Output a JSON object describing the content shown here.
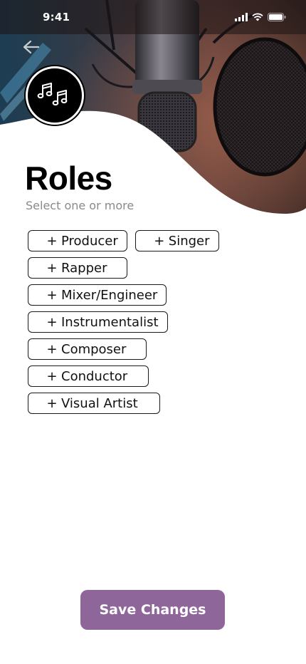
{
  "status_bar": {
    "time": "9:41"
  },
  "header": {
    "title": "Roles",
    "subtitle": "Select one or more"
  },
  "roles": [
    [
      "Producer",
      "Singer"
    ],
    [
      "Rapper"
    ],
    [
      "Mixer/Engineer"
    ],
    [
      "Instrumentalist"
    ],
    [
      "Composer"
    ],
    [
      "Conductor"
    ],
    [
      "Visual Artist"
    ]
  ],
  "role_prefix": "+",
  "actions": {
    "save_label": "Save Changes"
  },
  "colors": {
    "accent": "#8e6699",
    "chip_border": "#1a1a1a",
    "subtitle": "#8a8a8a"
  },
  "icons": {
    "back": "back-arrow-icon",
    "avatar": "music-notes-icon"
  }
}
